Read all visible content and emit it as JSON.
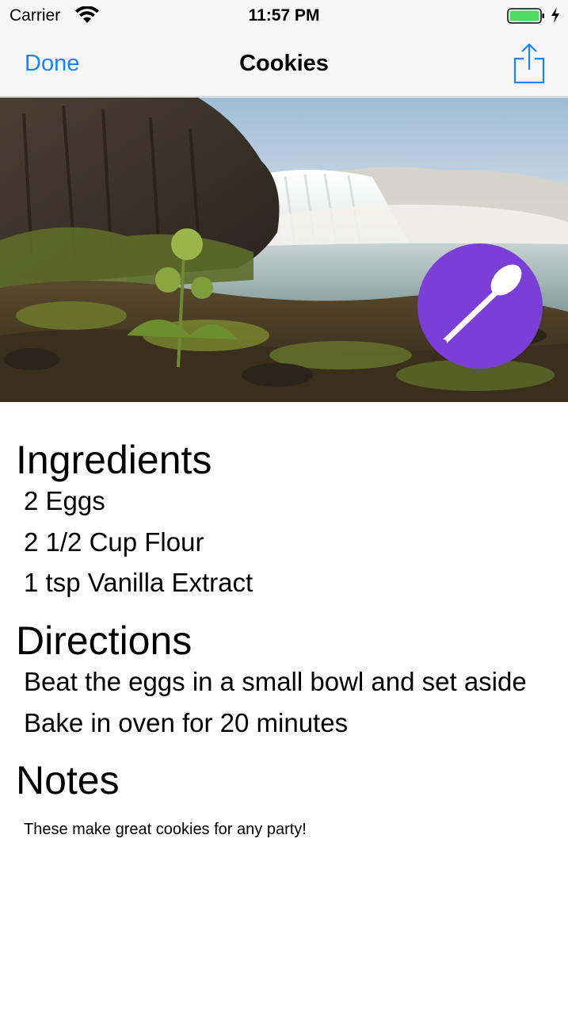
{
  "status_bar": {
    "carrier": "Carrier",
    "time": "11:57 PM",
    "battery_color": "#4cd964"
  },
  "nav_bar": {
    "done_label": "Done",
    "title": "Cookies",
    "accent_color": "#1a82fb",
    "share_icon": "share-icon"
  },
  "hero": {
    "spoon_button_color": "#7b3fd8",
    "spoon_icon": "spoon-icon"
  },
  "ingredients": {
    "heading": "Ingredients",
    "items": [
      "2 Eggs",
      "2 1/2 Cup Flour",
      "1 tsp Vanilla Extract"
    ]
  },
  "directions": {
    "heading": "Directions",
    "items": [
      "Beat the eggs in a small bowl and set aside",
      "Bake in oven for 20 minutes"
    ]
  },
  "notes": {
    "heading": "Notes",
    "text": "These make great cookies for any party!"
  }
}
